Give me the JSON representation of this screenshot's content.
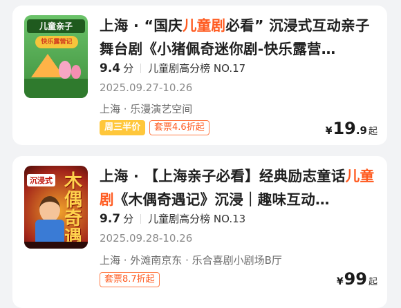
{
  "items": [
    {
      "title_prefix": "上海 · “国庆",
      "title_highlight": "儿童剧",
      "title_suffix": "必看” 沉浸式互动亲子舞台剧《小猪佩奇迷你剧-快乐露营…",
      "score": "9.4",
      "score_unit": "分",
      "rank": "儿童剧高分榜 NO.17",
      "date": "2025.09.27-10.26",
      "venue": "上海 · 乐漫演艺空间",
      "promo_tag": "周三半价",
      "discount_tag": "套票4.6折起",
      "price_currency": "¥",
      "price_int": "19",
      "price_dec": ".9",
      "price_suffix": "起",
      "poster": {
        "tag": "儿童亲子",
        "banner": "快乐露营记"
      }
    },
    {
      "title_prefix": "上海 · 【上海亲子必看】经典励志童话",
      "title_highlight": "儿童剧",
      "title_suffix": "《木偶奇遇记》沉浸｜趣味互动…",
      "score": "9.7",
      "score_unit": "分",
      "rank": "儿童剧高分榜 NO.13",
      "date": "2025.09.28-10.26",
      "venue": "上海 · 外滩南京东 · 乐合喜剧小剧场B厅",
      "discount_tag": "套票8.7折起",
      "price_currency": "¥",
      "price_int": "99",
      "price_suffix": "起",
      "poster": {
        "tag": "沉浸式",
        "big_text": "木偶奇遇记"
      }
    }
  ],
  "colors": {
    "highlight": "#ff5a1f",
    "promo": "#ffc73b",
    "background": "#f2f3f5"
  }
}
